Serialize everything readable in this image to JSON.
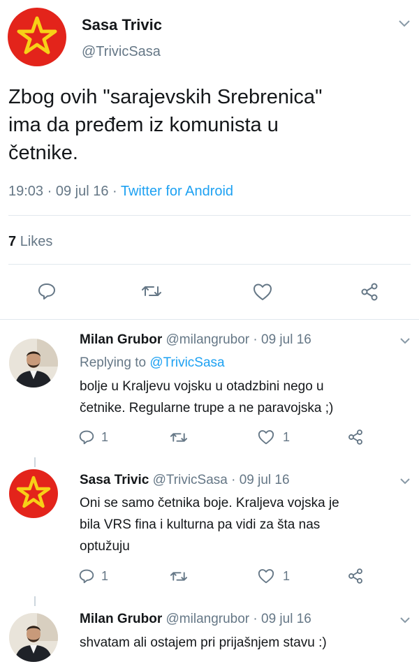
{
  "main_tweet": {
    "author_name": "Sasa Trivic",
    "handle": "@TrivicSasa",
    "text_line1": "Zbog ovih \"sarajevskih Srebrenica\"",
    "text_line2": "ima da pređem iz komunista u",
    "text_line3": "četnike.",
    "timestamp": "19:03 · 09 jul 16 · ",
    "source": "Twitter for Android",
    "likes_count": "7",
    "likes_label": "Likes"
  },
  "replies": [
    {
      "author_name": "Milan Grubor",
      "meta": "@milangrubor · 09 jul 16",
      "replying_label": "Replying to ",
      "replying_handle": "@TrivicSasa",
      "text_line1": "bolje u Kraljevu vojsku u otadzbini nego u",
      "text_line2": "četnike. Regularne trupe a ne paravojska ;)",
      "reply_count": "1",
      "like_count": "1"
    },
    {
      "author_name": "Sasa Trivic",
      "meta": "@TrivicSasa · 09 jul 16",
      "text_line1": "Oni se samo četnika boje. Kraljeva vojska je",
      "text_line2": "bila VRS  fina i kulturna pa vidi za šta nas",
      "text_line3": "optužuju",
      "reply_count": "1",
      "like_count": "1"
    },
    {
      "author_name": "Milan Grubor",
      "meta": "@milangrubor · 09 jul 16",
      "text_line1": "shvatam ali ostajem pri prijašnjem stavu :)"
    }
  ],
  "icons": {
    "reply": "reply-icon",
    "retweet": "retweet-icon",
    "like": "heart-icon",
    "share": "share-icon",
    "chevron": "chevron-down-icon"
  },
  "colors": {
    "link_blue": "#1da1f2",
    "secondary_grey": "#657786",
    "avatar_red": "#e3241b",
    "star_yellow": "#f7d117"
  }
}
